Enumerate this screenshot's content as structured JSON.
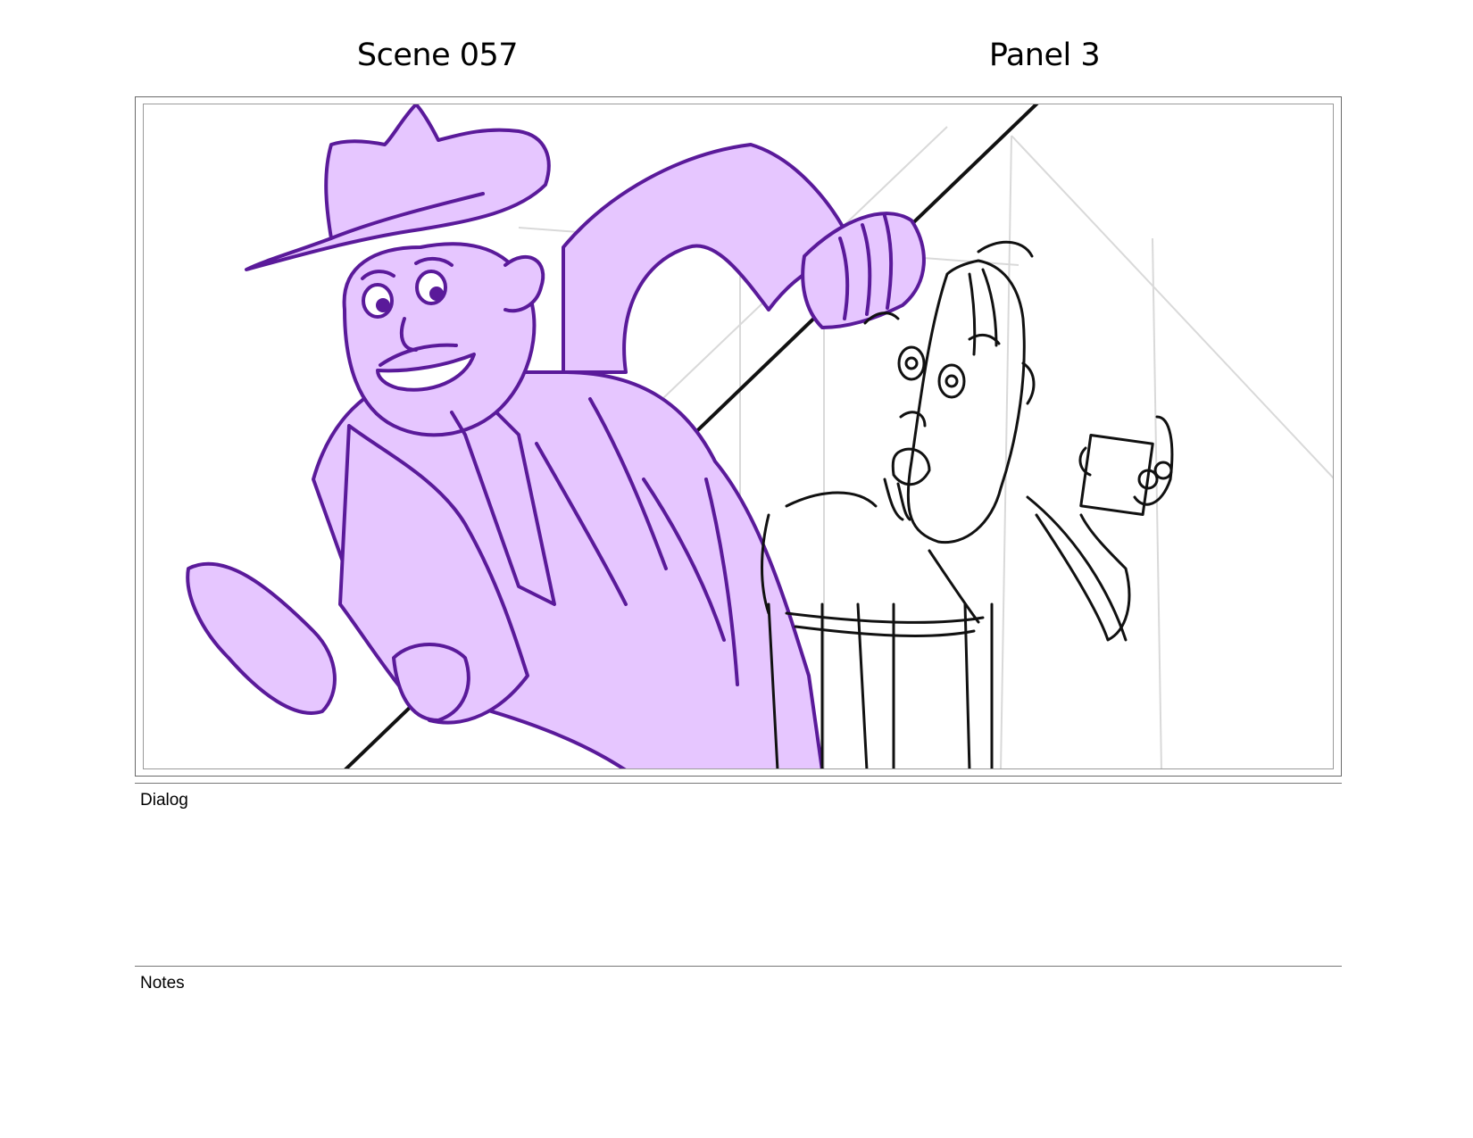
{
  "header": {
    "scene": "Scene 057",
    "panel": "Panel 3"
  },
  "sections": {
    "dialog_label": "Dialog",
    "dialog_text": "",
    "notes_label": "Notes",
    "notes_text": ""
  },
  "colors": {
    "purple_fill": "#e6c6ff",
    "purple_line": "#5a1a9a",
    "sketch_line": "#111111",
    "guide_line": "#c8c8c8"
  }
}
